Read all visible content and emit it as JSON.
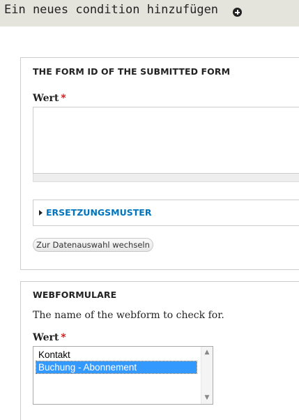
{
  "header": {
    "title": "Ein neues condition hinzufügen",
    "add_icon": "plus-circle-icon"
  },
  "form_id_fieldset": {
    "legend": "THE FORM ID OF THE SUBMITTED FORM",
    "value_label": "Wert",
    "required_mark": "*",
    "value": "",
    "replacement_patterns_label": "ERSETZUNGSMUSTER",
    "switch_button_label": "Zur Datenauswahl wechseln"
  },
  "webform_fieldset": {
    "legend": "WEBFORMULARE",
    "description": "The name of the webform to check for.",
    "value_label": "Wert",
    "required_mark": "*",
    "options": [
      "Kontakt",
      "Buchung - Abonnement"
    ],
    "selected_option": "Buchung - Abonnement"
  },
  "colors": {
    "header_bg": "#e4e4dc",
    "link": "#0074bd",
    "required": "#cc0000",
    "selection": "#3399ff"
  }
}
